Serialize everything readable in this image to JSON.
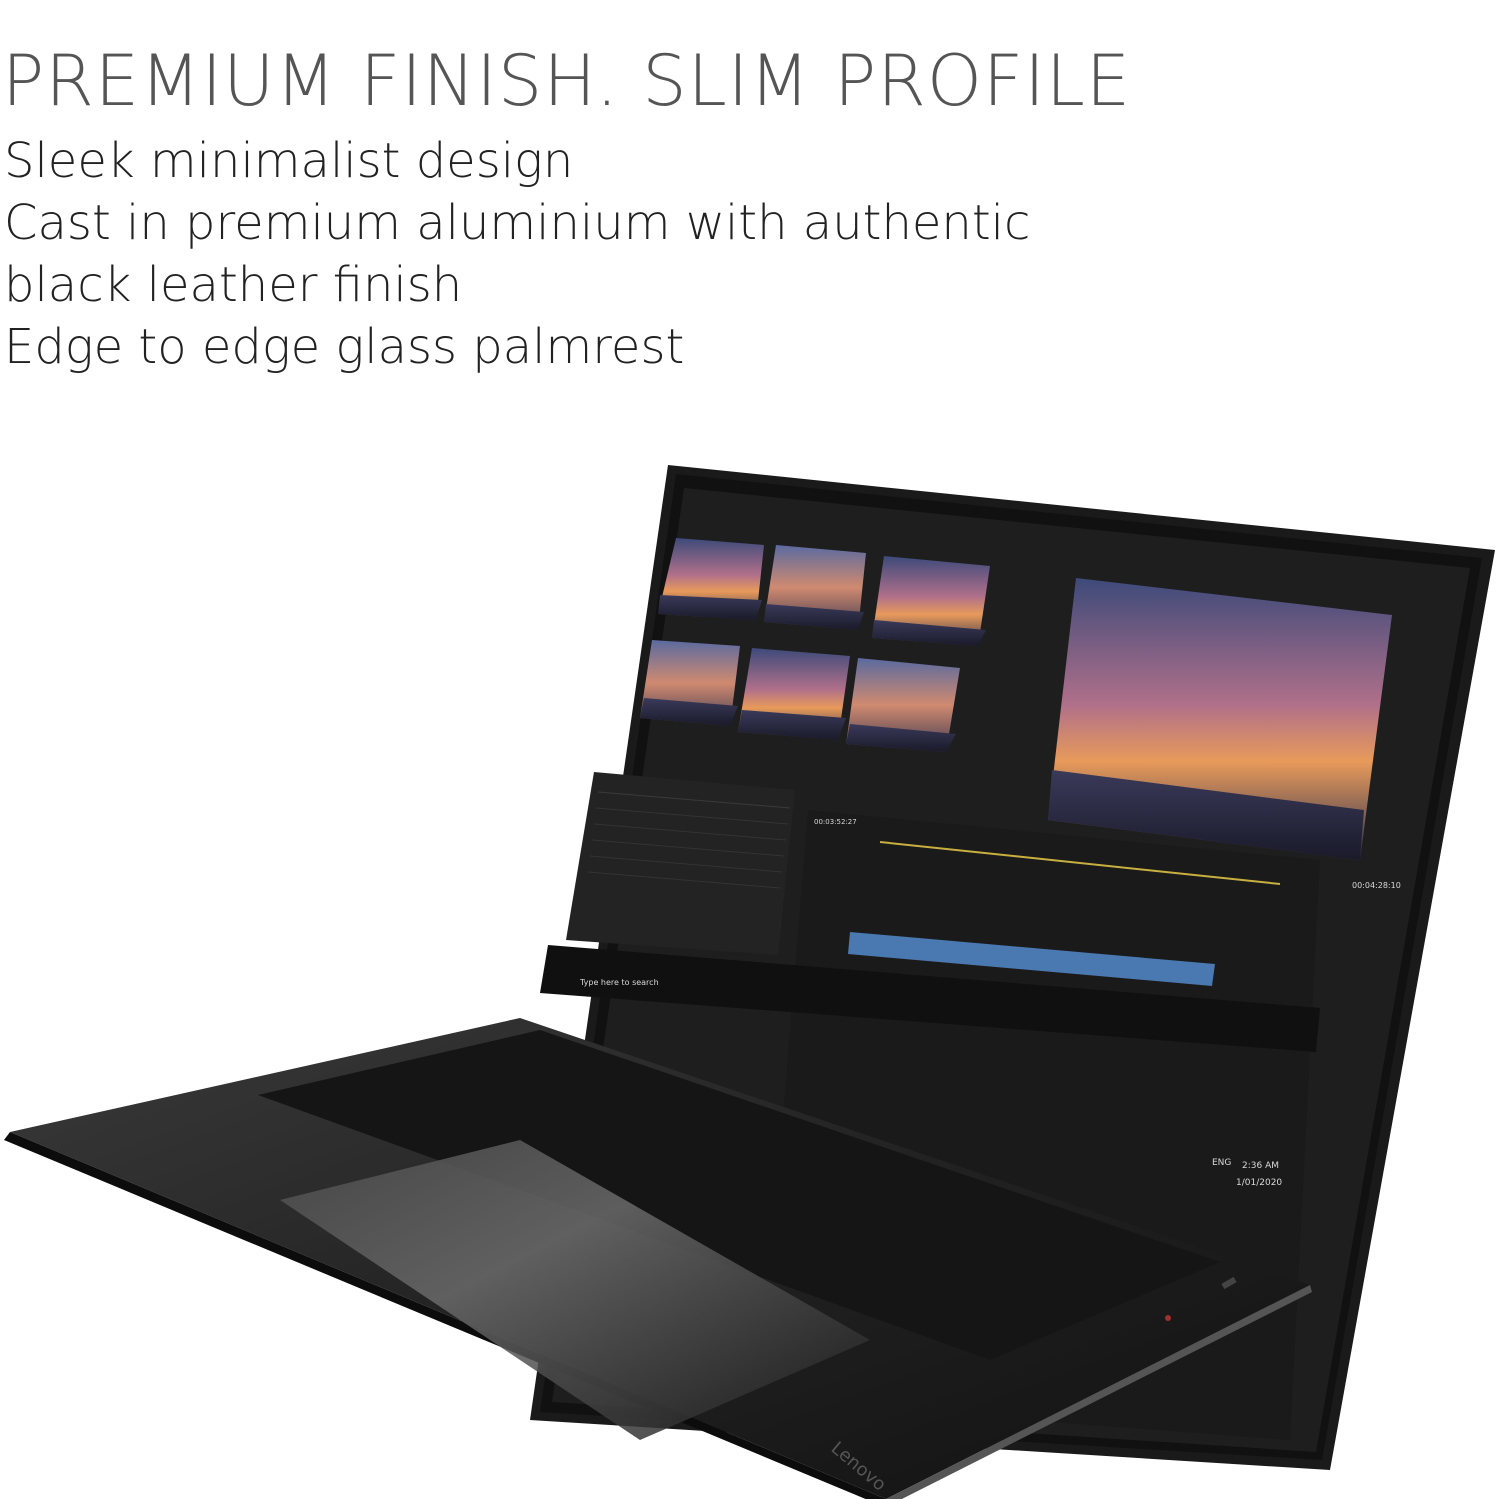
{
  "headline": "PREMIUM FINISH. SLIM PROFILE",
  "features": [
    "Sleek minimalist design",
    "Cast in premium aluminium with authentic",
    "black leather finish",
    "Edge to edge glass palmrest"
  ],
  "screen": {
    "search_placeholder": "Type here to search",
    "language": "ENG",
    "time": "2:36 AM",
    "date": "1/01/2020",
    "program_timecode": "00:04:28:10",
    "sequence_timecode": "00:03:52:27"
  },
  "branding": {
    "logo_text": "Lenovo"
  }
}
